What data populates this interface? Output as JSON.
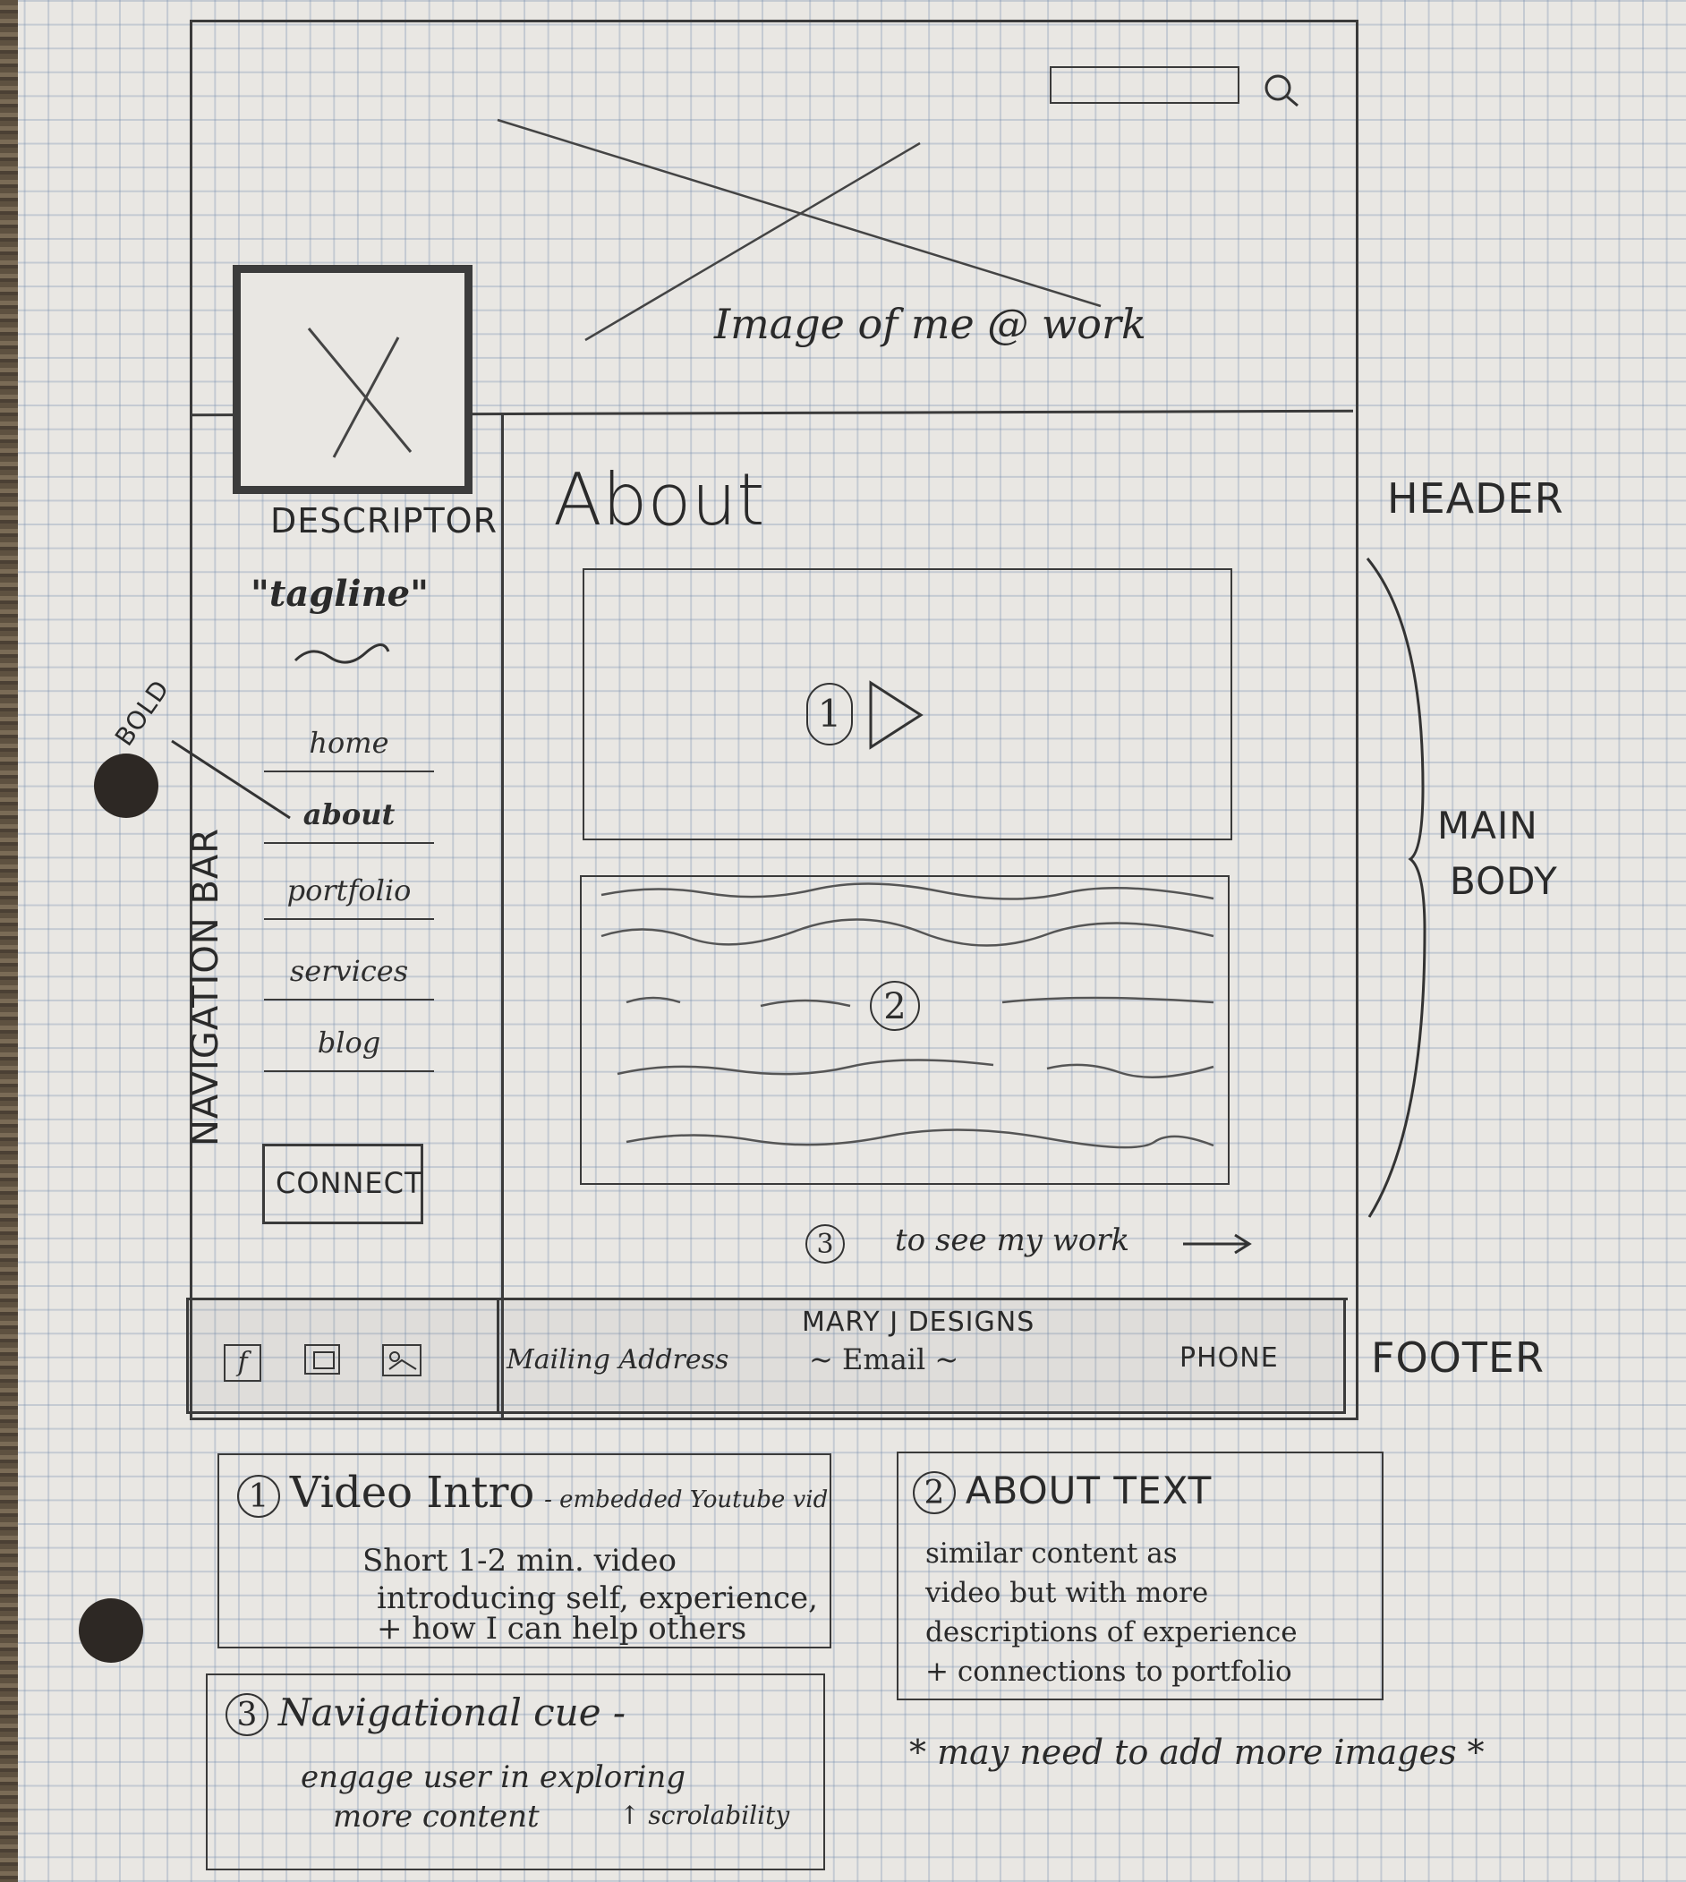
{
  "header": {
    "image_caption": "Image of me @ work",
    "side_label": "HEADER"
  },
  "sidebar": {
    "descriptor": "DESCRIPTOR",
    "tagline": "\"tagline\"",
    "bold_note": "BOLD",
    "vertical_label": "NAVIGATION BAR",
    "nav": [
      {
        "label": "home"
      },
      {
        "label": "about"
      },
      {
        "label": "portfolio"
      },
      {
        "label": "services"
      },
      {
        "label": "blog"
      }
    ],
    "connect_label": "CONNECT"
  },
  "main": {
    "title": "About",
    "video_marker": "1",
    "text_marker": "2",
    "cue_marker": "3",
    "cue_text": "to see my work",
    "side_label_line1": "MAIN",
    "side_label_line2": "BODY"
  },
  "footer": {
    "brand": "MARY J DESIGNS",
    "address": "Mailing Address",
    "email": "~ Email ~",
    "phone": "PHONE",
    "side_label": "FOOTER",
    "social_icons": [
      "facebook-icon",
      "image-icon",
      "image-icon"
    ]
  },
  "notes": {
    "video": {
      "marker": "1",
      "title": "Video Intro",
      "subtitle": "- embedded Youtube vid",
      "lines": [
        "Short 1-2 min. video",
        "introducing self, experience,",
        "+ how I can help others"
      ]
    },
    "about_text": {
      "marker": "2",
      "title": "ABOUT TEXT",
      "lines": [
        "similar content as",
        "video but with more",
        "descriptions of experience",
        "+ connections to portfolio"
      ]
    },
    "nav_cue": {
      "marker": "3",
      "title": "Navigational cue -",
      "lines": [
        "engage user in exploring",
        "more content"
      ],
      "extra": "↑ scrolability"
    },
    "images_note": "* may need to add more images *"
  }
}
